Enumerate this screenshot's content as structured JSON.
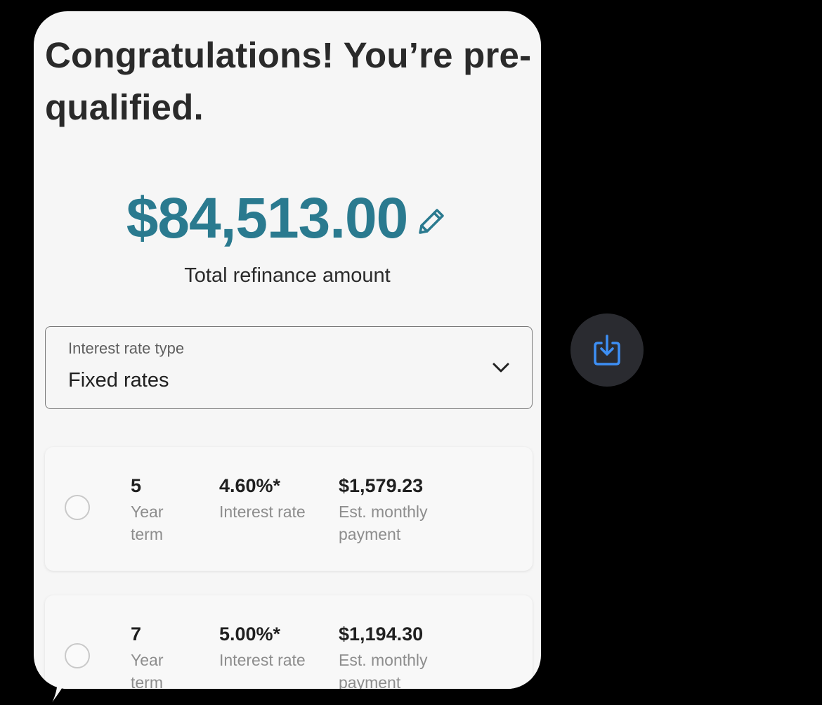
{
  "message": {
    "headline": "Congratulations! You’re pre-qualified.",
    "amount": "$84,513.00",
    "amount_label": "Total refinance amount",
    "edit_icon": "pencil-icon",
    "rate_select": {
      "label": "Interest rate type",
      "value": "Fixed rates",
      "icon": "chevron-down-icon"
    },
    "options": [
      {
        "term": "5",
        "term_label": "Year term",
        "rate": "4.60%*",
        "rate_label": "Interest rate",
        "payment": "$1,579.23",
        "payment_label": "Est. monthly payment"
      },
      {
        "term": "7",
        "term_label": "Year term",
        "rate": "5.00%*",
        "rate_label": "Interest rate",
        "payment": "$1,194.30",
        "payment_label": "Est. monthly payment"
      }
    ]
  },
  "save_button": {
    "icon": "save-download-icon",
    "color": "#3d8ff5"
  },
  "colors": {
    "accent": "#2a7a8f",
    "background": "#000000",
    "bubble": "#f6f6f6"
  }
}
